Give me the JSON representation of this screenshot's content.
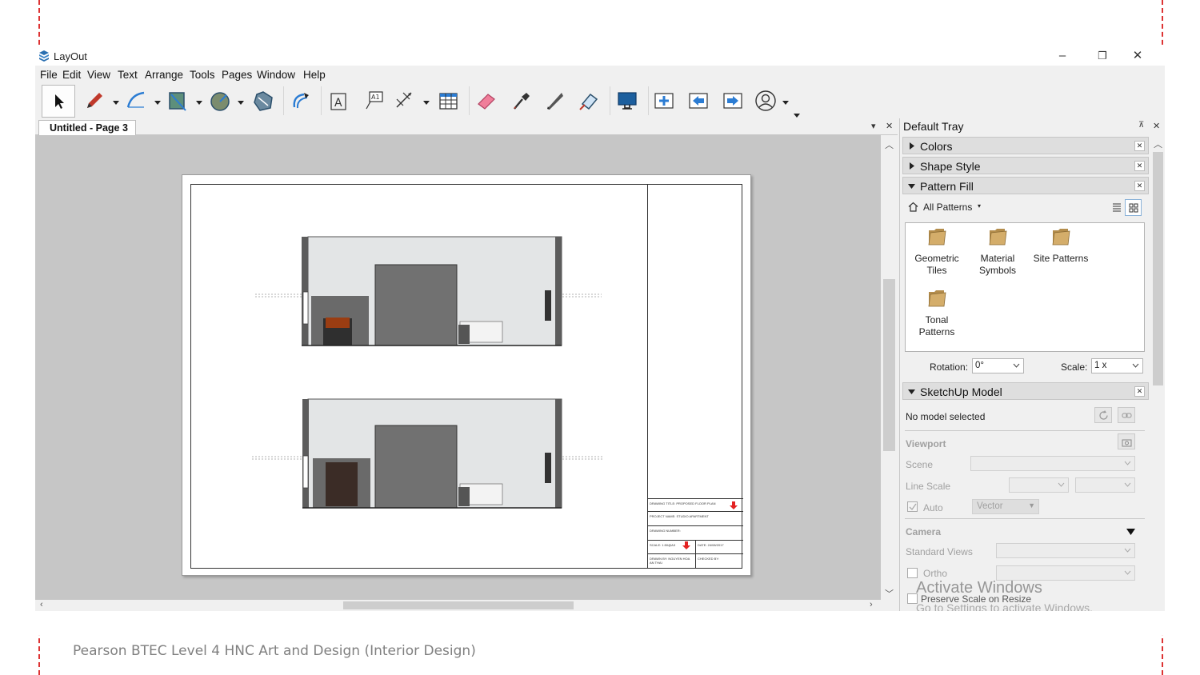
{
  "window": {
    "title": "LayOut",
    "controls": {
      "minimize": "–",
      "restore": "❐",
      "close": "✕"
    }
  },
  "menu": [
    "File",
    "Edit",
    "View",
    "Text",
    "Arrange",
    "Tools",
    "Pages",
    "Window",
    "Help"
  ],
  "toolbar": {
    "tools": [
      "select-icon",
      "pencil-icon",
      "arc-icon",
      "rectangle-icon",
      "circle-icon",
      "polygon-icon",
      "offset-icon",
      "text-icon",
      "label-icon",
      "dimension-icon",
      "table-icon",
      "eraser-icon",
      "eyedropper-icon",
      "split-icon",
      "join-icon",
      "presentation-icon",
      "add-page-icon",
      "previous-page-icon",
      "next-page-icon",
      "account-icon"
    ]
  },
  "document": {
    "tab_label": "Untitled - Page 3",
    "tab_menu": "▾",
    "tab_close": "✕"
  },
  "titleblock": {
    "drawing_title": "DRAWING TITLE: PROPOSED FLOOR PLAN",
    "project_name": "PROJECT NAME: STUDIO APARTMENT",
    "drawing_number": "DRAWING NUMBER:",
    "scale": "SCALE: 1:50@A3",
    "date": "DATE: 24/08/2017",
    "drawn_by": "DRAWN BY: NGUYEN HOA AN THAI",
    "checked_by": "CHECKED BY:"
  },
  "tray": {
    "title": "Default Tray",
    "pin": "⊼",
    "close": "✕",
    "panels": {
      "colors": "Colors",
      "shape_style": "Shape Style",
      "pattern_fill": "Pattern Fill",
      "sketchup_model": "SketchUp Model"
    },
    "pattern_fill": {
      "breadcrumb": "All Patterns",
      "breadcrumb_arrow": "▾",
      "folders": [
        {
          "line1": "Geometric",
          "line2": "Tiles"
        },
        {
          "line1": "Material",
          "line2": "Symbols"
        },
        {
          "line1": "Site Patterns",
          "line2": ""
        },
        {
          "line1": "Tonal",
          "line2": "Patterns"
        }
      ],
      "rotation_label": "Rotation:",
      "rotation_value": "0°",
      "scale_label": "Scale:",
      "scale_value": "1 x"
    },
    "sketchup_model": {
      "status": "No model selected",
      "viewport_label": "Viewport",
      "scene_label": "Scene",
      "line_scale_label": "Line Scale",
      "auto_label": "Auto",
      "render_mode": "Vector",
      "camera_label": "Camera",
      "standard_views_label": "Standard Views",
      "ortho_label": "Ortho",
      "preserve_label": "Preserve Scale on Resize"
    }
  },
  "watermark": {
    "line1": "Activate Windows",
    "line2": "Go to Settings to activate Windows."
  },
  "footer": "Pearson BTEC Level 4 HNC Art and Design (Interior Design)"
}
